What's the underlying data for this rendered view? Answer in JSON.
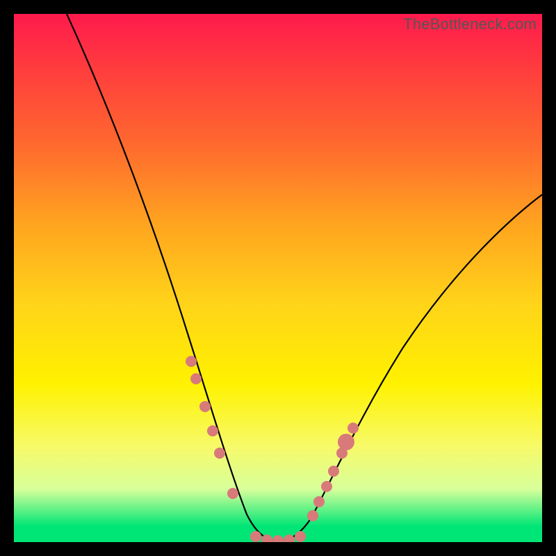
{
  "watermark": "TheBottleneck.com",
  "chart_data": {
    "type": "line",
    "title": "",
    "xlabel": "",
    "ylabel": "",
    "ylim": [
      0,
      100
    ],
    "xlim": [
      0,
      100
    ],
    "series": [
      {
        "name": "bottleneck-curve",
        "x": [
          10,
          15,
          20,
          25,
          30,
          33,
          36,
          39,
          42,
          45,
          48,
          50,
          53,
          56,
          59,
          62,
          68,
          75,
          82,
          90,
          100
        ],
        "values": [
          100,
          88,
          74,
          59,
          44,
          34,
          24,
          14,
          6,
          1,
          0,
          0,
          1,
          4,
          9,
          15,
          24,
          34,
          43,
          50,
          58
        ]
      }
    ],
    "markers": {
      "name": "highlight-dots",
      "color": "#d87a7a",
      "x": [
        33,
        34.5,
        36.5,
        38,
        39.5,
        42,
        46,
        48,
        50,
        52,
        54,
        56.5,
        57.5,
        59,
        60.5,
        62
      ],
      "values": [
        34,
        30,
        24,
        19,
        15,
        6,
        0,
        0,
        0,
        0,
        0,
        4,
        6,
        9,
        12,
        15
      ]
    },
    "background_gradient": {
      "top": "#ff1a4d",
      "mid": "#fff200",
      "bottom": "#00e676"
    }
  }
}
